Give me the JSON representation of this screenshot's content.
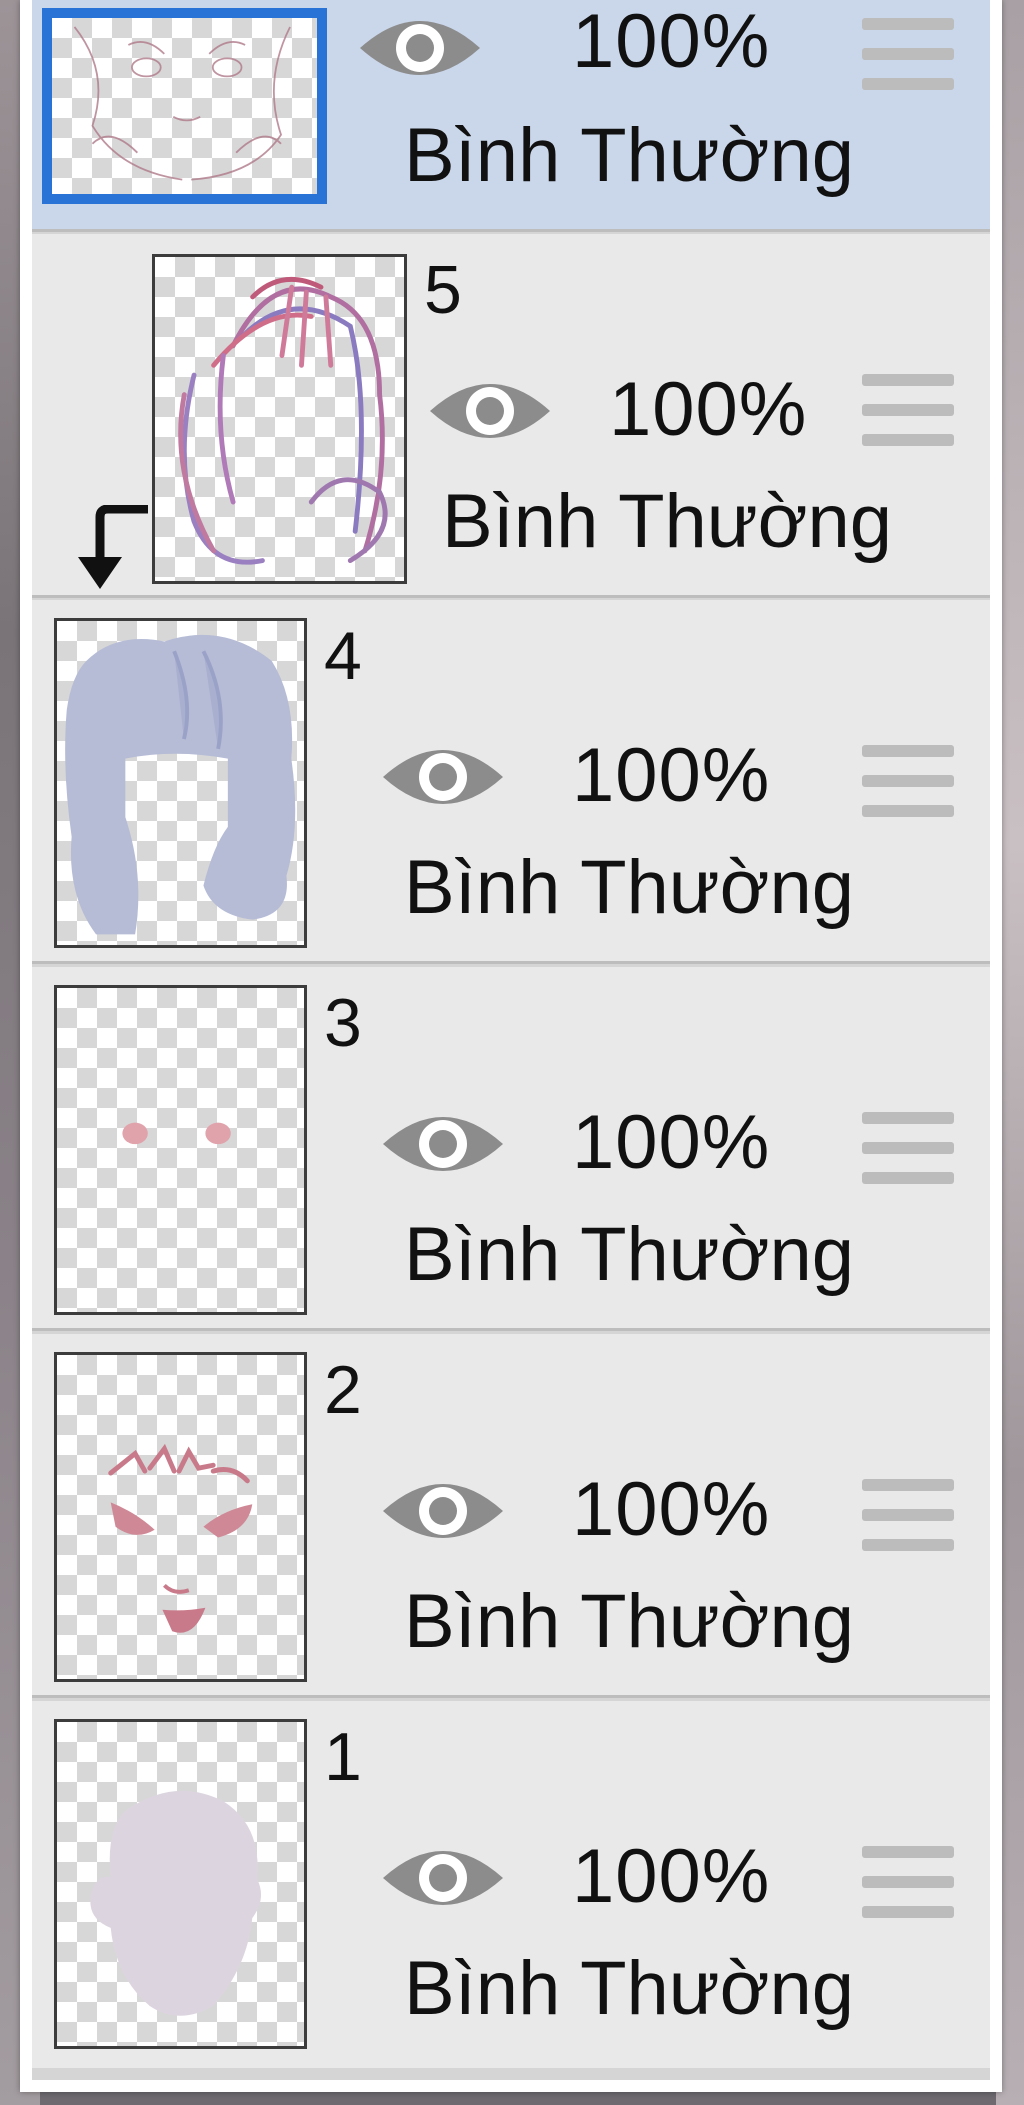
{
  "panel": {
    "layers": [
      {
        "number": "",
        "opacity": "100%",
        "blend_mode": "Bình Thường",
        "selected": true
      },
      {
        "number": "5",
        "opacity": "100%",
        "blend_mode": "Bình Thường",
        "clipped": true
      },
      {
        "number": "4",
        "opacity": "100%",
        "blend_mode": "Bình Thường"
      },
      {
        "number": "3",
        "opacity": "100%",
        "blend_mode": "Bình Thường"
      },
      {
        "number": "2",
        "opacity": "100%",
        "blend_mode": "Bình Thường"
      },
      {
        "number": "1",
        "opacity": "100%",
        "blend_mode": "Bình Thường"
      }
    ]
  },
  "colors": {
    "selected_row": "#cad7ea",
    "row": "#e9e9e9",
    "selection_border": "#2a73d6",
    "eye_icon": "#8c8c8c"
  }
}
